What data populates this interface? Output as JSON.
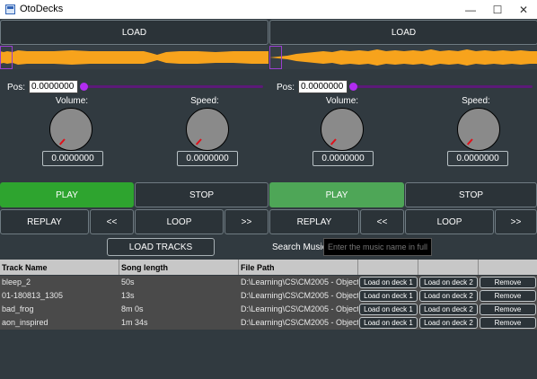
{
  "window": {
    "title": "OtoDecks",
    "minimize_glyph": "—",
    "maximize_glyph": "☐",
    "close_glyph": "✕"
  },
  "decks": [
    {
      "load_label": "LOAD",
      "pos_label": "Pos:",
      "pos_value": "0.0000000",
      "pos_fraction": 0.0,
      "volume_label": "Volume:",
      "volume_value": "0.0000000",
      "speed_label": "Speed:",
      "speed_value": "0.0000000",
      "play_label": "PLAY",
      "stop_label": "STOP",
      "replay_label": "REPLAY",
      "rewind_label": "<<",
      "loop_label": "LOOP",
      "forward_label": ">>"
    },
    {
      "load_label": "LOAD",
      "pos_label": "Pos:",
      "pos_value": "0.0000000",
      "pos_fraction": 0.0,
      "volume_label": "Volume:",
      "volume_value": "0.0000000",
      "speed_label": "Speed:",
      "speed_value": "0.0000000",
      "play_label": "PLAY",
      "stop_label": "STOP",
      "replay_label": "REPLAY",
      "rewind_label": "<<",
      "loop_label": "LOOP",
      "forward_label": ">>"
    }
  ],
  "library": {
    "load_tracks_label": "LOAD TRACKS",
    "search_label": "Search Music:",
    "search_placeholder": "Enter the music name in full",
    "columns": [
      "Track Name",
      "Song length",
      "File Path",
      "",
      "",
      ""
    ],
    "rows": [
      {
        "name": "bleep_2",
        "length": "50s",
        "path": "D:\\Learning\\CS\\CM2005 - Object"
      },
      {
        "name": "01-180813_1305",
        "length": "13s",
        "path": "D:\\Learning\\CS\\CM2005 - Object"
      },
      {
        "name": "bad_frog",
        "length": "8m 0s",
        "path": "D:\\Learning\\CS\\CM2005 - Object"
      },
      {
        "name": "aon_inspired",
        "length": "1m 34s",
        "path": "D:\\Learning\\CS\\CM2005 - Object"
      }
    ],
    "row_actions": {
      "deck1": "Load on deck 1",
      "deck2": "Load on deck 2",
      "remove": "Remove"
    }
  },
  "colors": {
    "waveform": "#f7a31c",
    "play_active": "#2ea42f",
    "play_alt": "#4ea657",
    "slider_thumb": "#b12cf0",
    "knob_tick": "#e0101a"
  }
}
